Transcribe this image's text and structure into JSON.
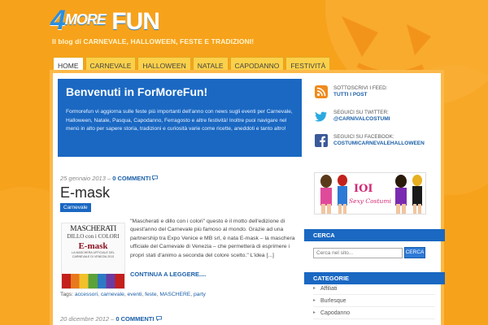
{
  "site": {
    "logo": {
      "four": "4",
      "more": "MORE",
      "fun": "FUN"
    },
    "tagline": "Il blog di CARNEVALE, HALLOWEEN, FESTE E TRADIZIONI!"
  },
  "nav": {
    "items": [
      {
        "label": "HOME",
        "active": true
      },
      {
        "label": "CARNEVALE"
      },
      {
        "label": "HALLOWEEN"
      },
      {
        "label": "NATALE"
      },
      {
        "label": "CAPODANNO"
      },
      {
        "label": "FESTIVITÀ"
      }
    ]
  },
  "welcome": {
    "title": "Benvenuti in ForMoreFun!",
    "text": "Formorefun vi aggiorna sulle feste più importanti dell'anno con news sugli eventi per Carnevale, Halloween, Natale, Pasqua, Capodanno, Ferragosto e altre festività! Inoltre puoi navigare nel menù in alto per sapere storia, tradizioni e curiosità varie come ricette, aneddoti e tanto altro!"
  },
  "social": [
    {
      "icon": "rss-feed-icon",
      "label": "SOTTOSCRIVI I FEED:",
      "value": "TUTTI I POST"
    },
    {
      "icon": "twitter-bird-icon",
      "label": "SEGUICI SU TWITTER:",
      "value": "@CARNIVALCOSTUMI"
    },
    {
      "icon": "facebook-icon",
      "label": "SEGUICI SU FACEBOOK:",
      "value": "COSTUMICARNEVALEHALLOWEEN"
    }
  ],
  "post": {
    "date": "25 gennaio 2013",
    "sep": " – ",
    "comments": "0 COMMENTI",
    "title": "E-mask",
    "category": "Carnevale",
    "thumb": {
      "title": "MASCHERATI",
      "sub": "DILLO con i COLORI",
      "brand": "E-mask",
      "tiny": "LA MASCHERA UFFICIALE DEL CARNEVALE DI VENEZIA 2013"
    },
    "excerpt": "\"Mascherati e dillo con i colori\" questo è il motto dell'edizione di quest'anno del Carnevale più famoso al mondo. Grazie ad una partnership tra Expo Venice e MB srl, è nata E-mask – la maschera ufficiale del Carnevale di Venezia – che permetterà di esprimere i propri stati d'animo a seconda del colore scelto.\" L'idea [...]",
    "read_more": "CONTINUA A LEGGERE....",
    "tags_label": "Tags: ",
    "tags": [
      "accessori",
      "carnevale",
      "eventi",
      "feste",
      "MASCHERE",
      "party"
    ]
  },
  "post2": {
    "date": "20 dicembre 2012",
    "sep": " – ",
    "comments": "0 COMMENTI"
  },
  "sidebar": {
    "ad": {
      "brand": "IOI",
      "tag": "Sexy Costumi"
    },
    "search": {
      "title": "CERCA",
      "placeholder": "Cerca nel sito...",
      "button": "CERCA"
    },
    "categories": {
      "title": "CATEGORIE",
      "items": [
        "Affiliati",
        "Burlesque",
        "Capodanno"
      ]
    }
  },
  "colors": {
    "background": "#f7a21b",
    "accent": "#1a68c2",
    "link": "#1a5fa8"
  }
}
